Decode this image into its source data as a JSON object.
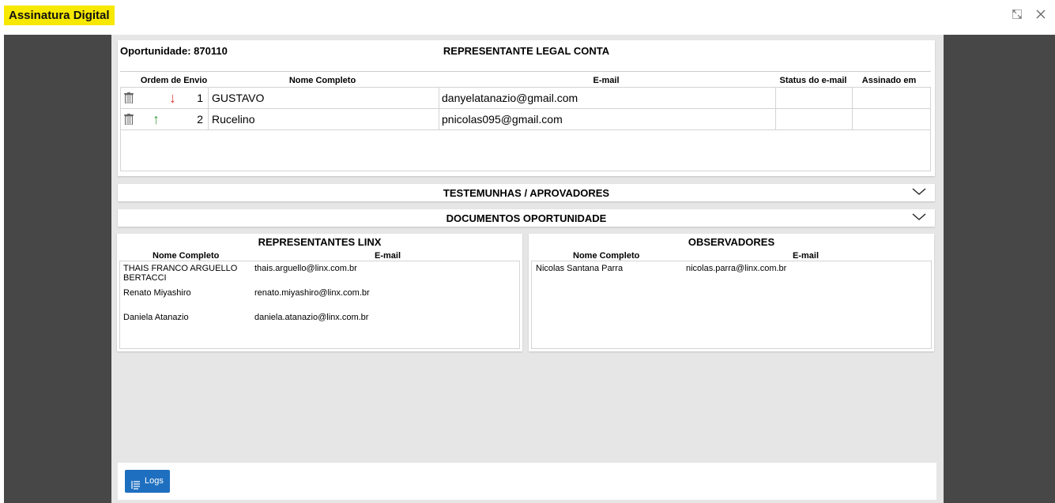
{
  "app": {
    "title": "Assinatura Digital"
  },
  "legal": {
    "opportunity_label": "Oportunidade: 870110",
    "section_title": "REPRESENTANTE LEGAL CONTA",
    "columns": [
      "Ordem de Envio",
      "Nome Completo",
      "E-mail",
      "Status do e-mail",
      "Assinado em"
    ],
    "rows": [
      {
        "order": "1",
        "name": "GUSTAVO",
        "email": "danyelatanazio@gmail.com",
        "status": "",
        "signed_at": "",
        "arrow": "down"
      },
      {
        "order": "2",
        "name": "Rucelino",
        "email": "pnicolas095@gmail.com",
        "status": "",
        "signed_at": "",
        "arrow": "up"
      }
    ]
  },
  "accordions": {
    "witnesses": "TESTEMUNHAS / APROVADORES",
    "documents": "DOCUMENTOS OPORTUNIDADE"
  },
  "linx": {
    "title": "REPRESENTANTES LINX",
    "col_name": "Nome Completo",
    "col_email": "E-mail",
    "items": [
      {
        "name_line1": "THAIS FRANCO ARGUELLO",
        "name_line2": "BERTACCI",
        "email": "thais.arguello@linx.com.br"
      },
      {
        "name_line1": "Renato Miyashiro",
        "name_line2": "",
        "email": "renato.miyashiro@linx.com.br"
      },
      {
        "name_line1": "Daniela Atanazio",
        "name_line2": "",
        "email": "daniela.atanazio@linx.com.br"
      }
    ]
  },
  "observers": {
    "title": "OBSERVADORES",
    "col_name": "Nome Completo",
    "col_email": "E-mail",
    "items": [
      {
        "name": "Nicolas Santana Parra",
        "email": "nicolas.parra@linx.com.br"
      }
    ]
  },
  "footer": {
    "logs_label": "Logs"
  },
  "colors": {
    "title_highlight": "#f7e800",
    "sidebar": "#474747",
    "arrow_down": "#e53935",
    "arrow_up": "#43a047",
    "logs_button": "#1f6fc0"
  }
}
